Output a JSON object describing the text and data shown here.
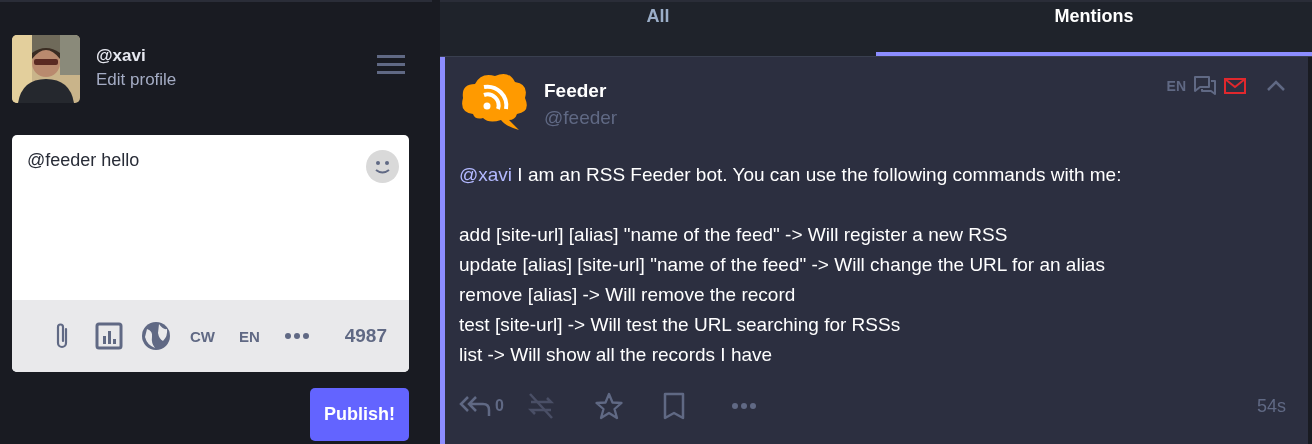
{
  "profile": {
    "handle": "@xavi",
    "edit_link": "Edit profile"
  },
  "compose": {
    "value": "@feeder hello",
    "cw": "CW",
    "language": "EN",
    "char_count": "4987",
    "publish": "Publish!"
  },
  "tabs": [
    {
      "label": "All",
      "selected": false
    },
    {
      "label": "Mentions",
      "selected": true
    }
  ],
  "status": {
    "name": "Feeder",
    "handle": "@feeder",
    "language": "EN",
    "mention": "@xavi",
    "intro": "I am an RSS Feeder bot. You can use the following commands with me:",
    "lines": [
      "add [site-url] [alias] \"name of the feed\" -> Will register a new RSS",
      "update [alias] [site-url] \"name of the feed\" -> Will change the URL for an alias",
      "remove [alias] -> Will remove the record",
      "test [site-url] -> Will test the URL searching for RSSs",
      "list -> Will show all the records I have"
    ],
    "reply_count": "0",
    "time": "54s"
  }
}
